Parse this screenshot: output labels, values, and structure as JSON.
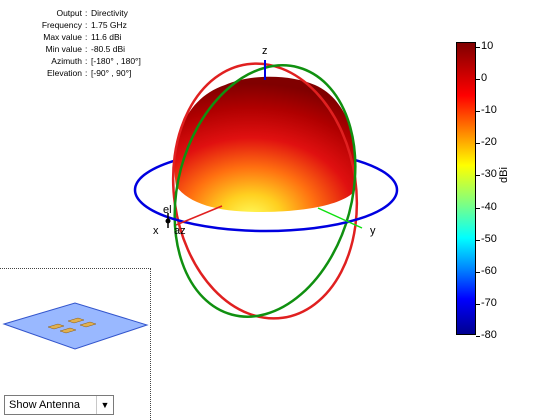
{
  "info": [
    {
      "label": "Output",
      "value": "Directivity"
    },
    {
      "label": "Frequency",
      "value": "1.75 GHz"
    },
    {
      "label": "Max value",
      "value": "11.6 dBi"
    },
    {
      "label": "Min value",
      "value": "-80.5 dBi"
    },
    {
      "label": "Azimuth",
      "value": "[-180° , 180°]"
    },
    {
      "label": "Elevation",
      "value": "[-90° , 90°]"
    }
  ],
  "axes": {
    "x": "x",
    "y": "y",
    "z": "z",
    "el": "el",
    "az": "az"
  },
  "colorbar": {
    "ticks": [
      "10",
      "0",
      "-10",
      "-20",
      "-30",
      "-40",
      "-50",
      "-60",
      "-70",
      "-80"
    ],
    "unit": "dBi"
  },
  "dropdown": {
    "selected": "Show Antenna"
  },
  "colors": {
    "azimuth_circle": "#0000e0",
    "elevation_circle_x": "#e02020",
    "elevation_circle_y": "#109010"
  }
}
